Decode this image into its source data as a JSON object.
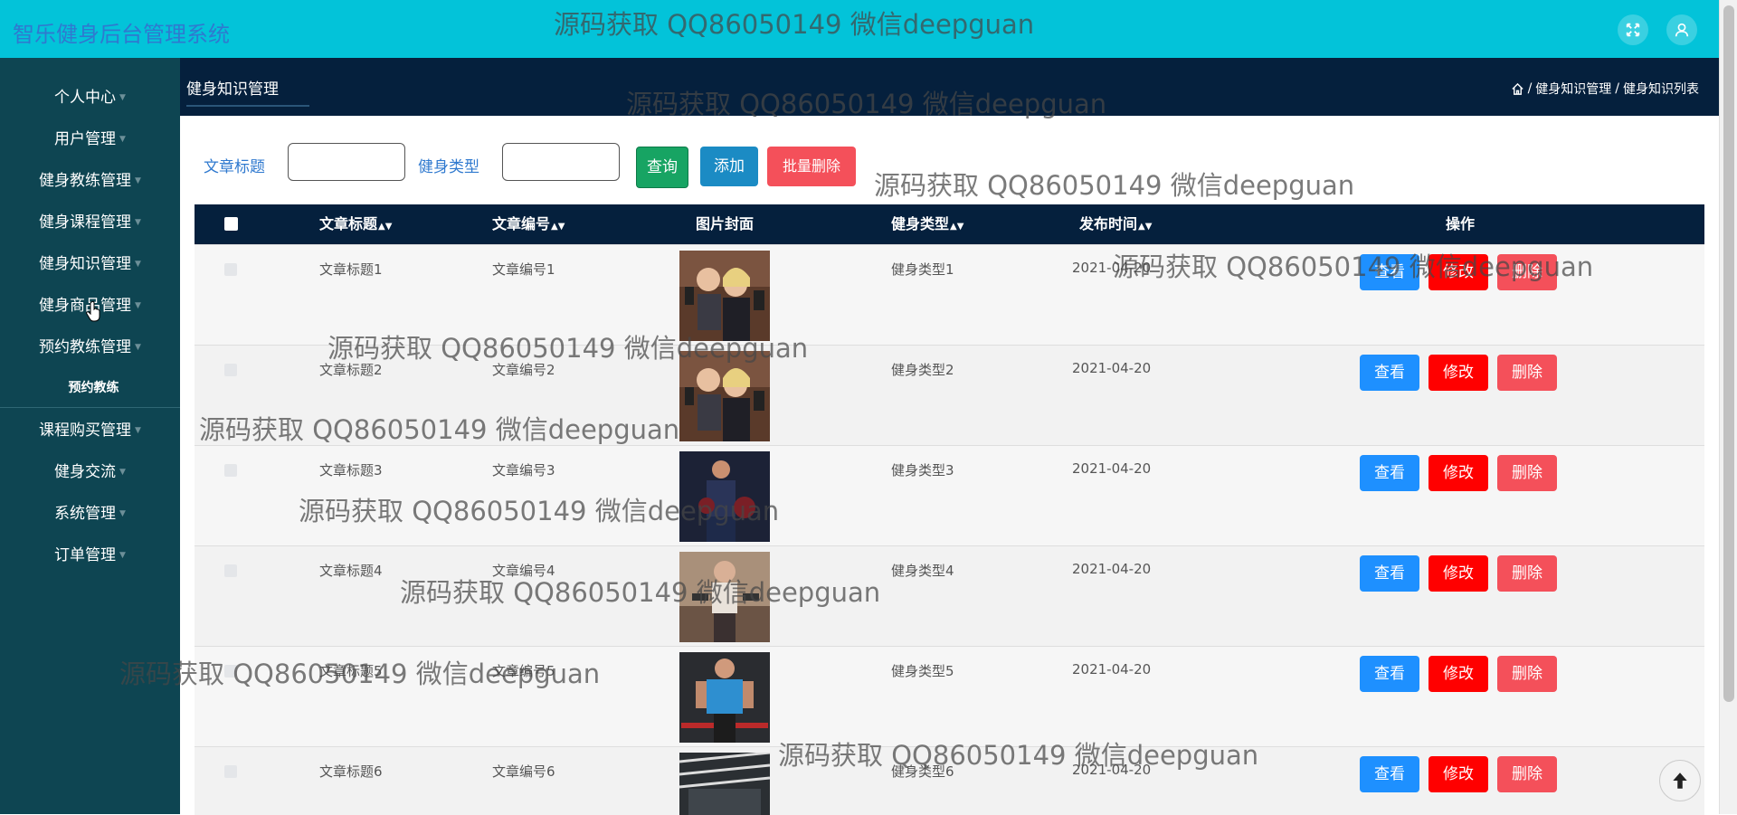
{
  "app": {
    "title": "智乐健身后台管理系统"
  },
  "header_icons": [
    {
      "icon": "fullscreen-icon"
    },
    {
      "icon": "user-icon"
    }
  ],
  "sidebar": {
    "items": [
      {
        "label": "个人中心"
      },
      {
        "label": "用户管理"
      },
      {
        "label": "健身教练管理"
      },
      {
        "label": "健身课程管理"
      },
      {
        "label": "健身知识管理"
      },
      {
        "label": "健身商品管理"
      },
      {
        "label": "预约教练管理"
      },
      {
        "label": "课程购买管理"
      },
      {
        "label": "健身交流"
      },
      {
        "label": "系统管理"
      },
      {
        "label": "订单管理"
      }
    ],
    "expanded_sub": {
      "label": "预约教练"
    }
  },
  "content_header": {
    "tab": "健身知识管理",
    "breadcrumb": [
      "健身知识管理",
      "健身知识列表"
    ],
    "separator": "/"
  },
  "search": {
    "title_label": "文章标题",
    "title_value": "",
    "type_label": "健身类型",
    "type_value": "",
    "query_button": "查询",
    "add_button": "添加",
    "batch_delete_button": "批量删除"
  },
  "table": {
    "columns": [
      "文章标题",
      "文章编号",
      "图片封面",
      "健身类型",
      "发布时间",
      "操作"
    ],
    "sortable": [
      true,
      true,
      false,
      true,
      true,
      false
    ],
    "rows": [
      {
        "title": "文章标题1",
        "code": "文章编号1",
        "type": "健身类型1",
        "time": "2021-04-20",
        "image": "gym-couple-photo"
      },
      {
        "title": "文章标题2",
        "code": "文章编号2",
        "type": "健身类型2",
        "time": "2021-04-20",
        "image": "gym-couple-photo"
      },
      {
        "title": "文章标题3",
        "code": "文章编号3",
        "type": "健身类型3",
        "time": "2021-04-20",
        "image": "boxing-woman-photo"
      },
      {
        "title": "文章标题4",
        "code": "文章编号4",
        "type": "健身类型4",
        "time": "2021-04-20",
        "image": "dumbbell-woman-photo"
      },
      {
        "title": "文章标题5",
        "code": "文章编号5",
        "type": "健身类型5",
        "time": "2021-04-20",
        "image": "barbell-man-photo"
      },
      {
        "title": "文章标题6",
        "code": "文章编号6",
        "type": "健身类型6",
        "time": "2021-04-20",
        "image": "gym-interior-photo"
      }
    ],
    "row_actions": {
      "view": "查看",
      "edit": "修改",
      "delete": "删除"
    }
  },
  "watermark": "源码获取 QQ86050149 微信deepguan",
  "colors": {
    "topbar": "#03c3d9",
    "sidebar": "#0e4552",
    "content_header": "#05203d",
    "query_button": "#17a463",
    "add_button": "#1b8bc4",
    "batch_delete_button": "#f4505a",
    "view_button": "#1e90ff",
    "edit_button": "#ff0000",
    "delete_button": "#f4505a"
  }
}
